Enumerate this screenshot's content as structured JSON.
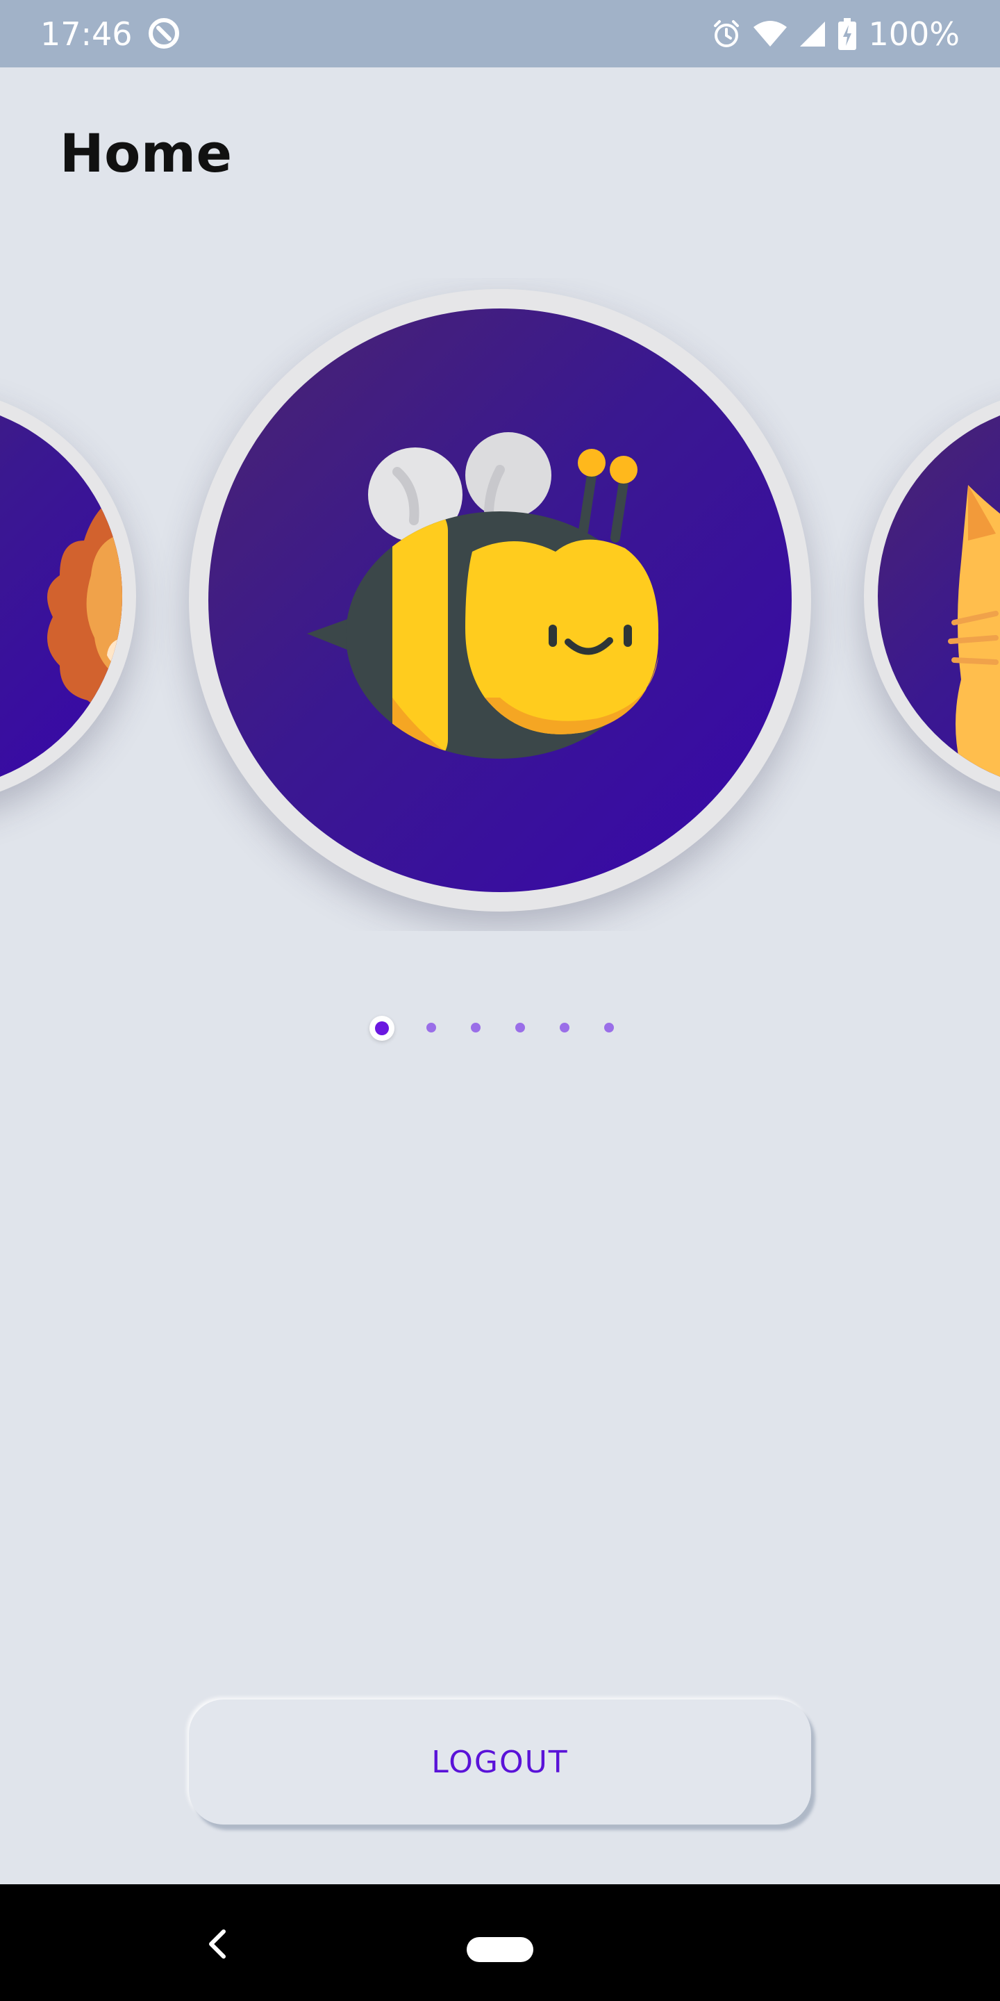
{
  "status_bar": {
    "time": "17:46",
    "battery": "100%",
    "icons": [
      "app-notification-icon",
      "alarm-icon",
      "wifi-icon",
      "cell-signal-icon",
      "battery-charging-icon"
    ]
  },
  "header": {
    "title": "Home"
  },
  "carousel": {
    "items": [
      {
        "name": "lion-avatar",
        "icon": "lion-icon"
      },
      {
        "name": "bee-avatar",
        "icon": "bee-icon"
      },
      {
        "name": "cat-avatar",
        "icon": "cat-icon"
      }
    ],
    "page_count": 6,
    "active_index": 0
  },
  "actions": {
    "logout_label": "LOGOUT"
  },
  "nav_bar": {
    "icons": [
      "back-icon",
      "home-pill-icon"
    ]
  },
  "colors": {
    "background": "#e0e4eb",
    "status_bar": "#a1b2c8",
    "accent": "#5a12d8",
    "avatar_bg": "#3807aa",
    "bee_yellow": "#ffcc1e",
    "bee_dark": "#3b4749"
  }
}
